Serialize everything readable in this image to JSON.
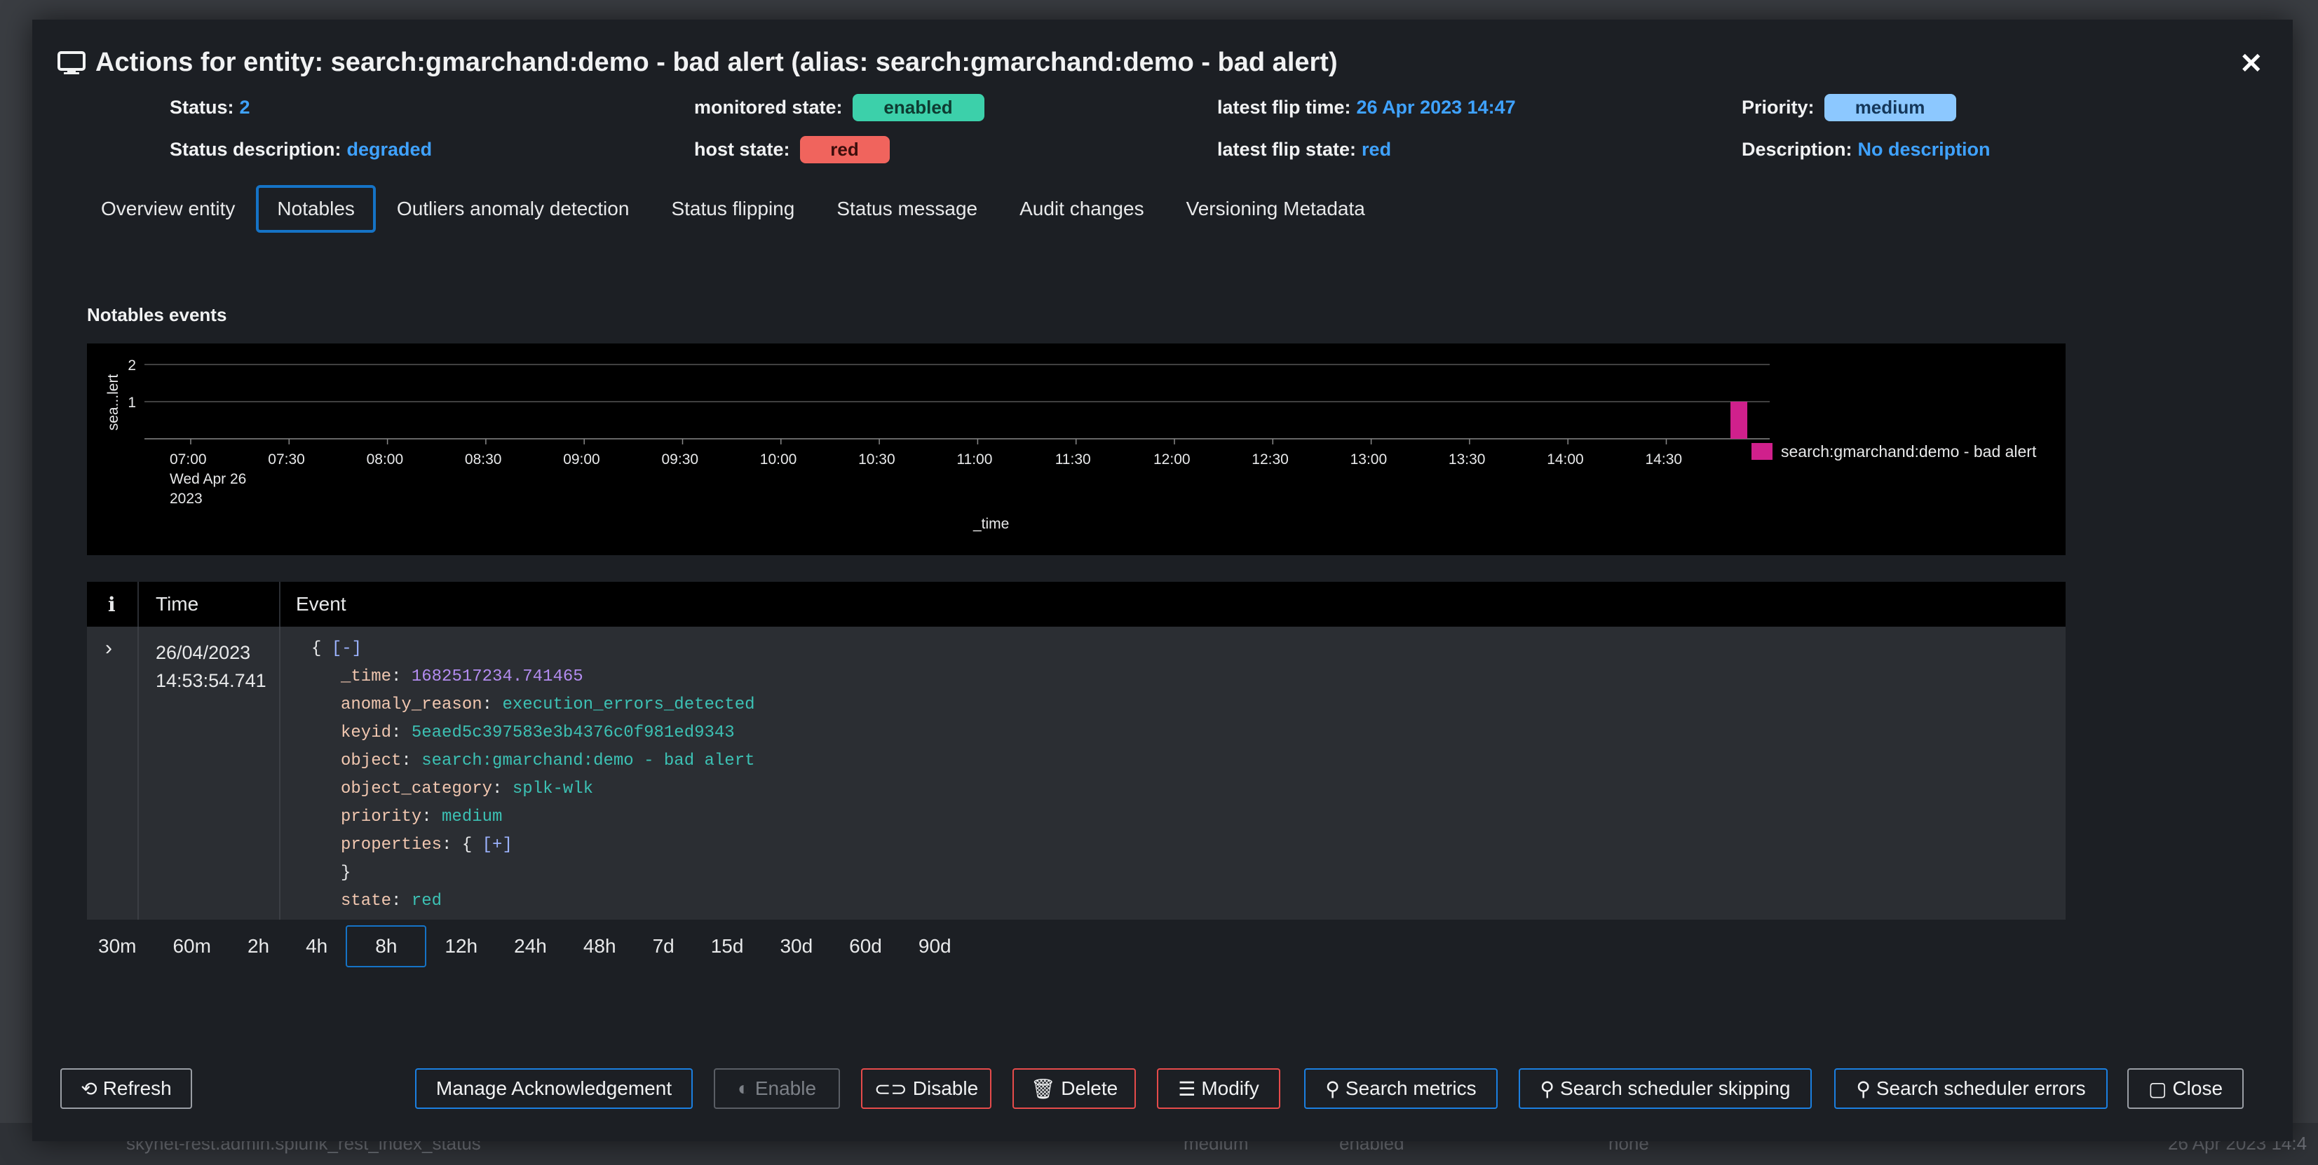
{
  "modal": {
    "title": "Actions for entity: search:gmarchand:demo - bad alert (alias: search:gmarchand:demo - bad alert)"
  },
  "info": {
    "status_label": "Status:",
    "status_value": "2",
    "status_desc_label": "Status description:",
    "status_desc_value": "degraded",
    "monitored_label": "monitored state:",
    "monitored_value": "enabled",
    "host_label": "host state:",
    "host_value": "red",
    "flip_time_label": "latest flip time:",
    "flip_time_value": "26 Apr 2023 14:47",
    "flip_state_label": "latest flip state:",
    "flip_state_value": "red",
    "priority_label": "Priority:",
    "priority_value": "medium",
    "description_label": "Description:",
    "description_value": "No description"
  },
  "tabs": [
    {
      "label": "Overview entity"
    },
    {
      "label": "Notables",
      "active": true
    },
    {
      "label": "Outliers anomaly detection"
    },
    {
      "label": "Status flipping"
    },
    {
      "label": "Status message"
    },
    {
      "label": "Audit changes"
    },
    {
      "label": "Versioning Metadata"
    }
  ],
  "section": {
    "title": "Notables events"
  },
  "chart_data": {
    "type": "bar",
    "ylabel": "sea...lert",
    "xlabel": "_time",
    "yticks": [
      "2",
      "1"
    ],
    "ylim": [
      0,
      2
    ],
    "x_ticks": [
      "07:00",
      "07:30",
      "08:00",
      "08:30",
      "09:00",
      "09:30",
      "10:00",
      "10:30",
      "11:00",
      "11:30",
      "12:00",
      "12:30",
      "13:00",
      "13:30",
      "14:00",
      "14:30"
    ],
    "first_tick_date": [
      "Wed Apr 26",
      "2023"
    ],
    "series": [
      {
        "name": "search:gmarchand:demo - bad alert",
        "color": "#d0208c",
        "points": [
          {
            "x": "14:50",
            "y": 1
          }
        ]
      }
    ],
    "legend": "right",
    "grid": true
  },
  "table": {
    "headers": {
      "info": "i",
      "time": "Time",
      "event": "Event"
    },
    "row": {
      "date": "26/04/2023",
      "time": "14:53:54.741",
      "open": "{",
      "collapse": "[-]",
      "fields": [
        {
          "key": "_time",
          "value": "1682517234.741465",
          "kind": "n"
        },
        {
          "key": "anomaly_reason",
          "value": "execution_errors_detected",
          "kind": "s"
        },
        {
          "key": "keyid",
          "value": "5eaed5c397583e3b4376c0f981ed9343",
          "kind": "s"
        },
        {
          "key": "object",
          "value": "search:gmarchand:demo - bad alert",
          "kind": "s"
        },
        {
          "key": "object_category",
          "value": "splk-wlk",
          "kind": "s"
        },
        {
          "key": "priority",
          "value": "medium",
          "kind": "s"
        }
      ],
      "properties_key": "properties",
      "properties_open": "{",
      "expand": "[+]",
      "close": "}",
      "state_key": "state",
      "state_value": "red"
    }
  },
  "ranges": [
    "30m",
    "60m",
    "2h",
    "4h",
    "8h",
    "12h",
    "24h",
    "48h",
    "7d",
    "15d",
    "30d",
    "60d",
    "90d"
  ],
  "active_range": "8h",
  "buttons": {
    "refresh": "Refresh",
    "ack": "Manage Acknowledgement",
    "enable": "Enable",
    "disable": "Disable",
    "delete": "Delete",
    "modify": "Modify",
    "search_metrics": "Search metrics",
    "search_skipping": "Search scheduler skipping",
    "search_errors": "Search scheduler errors",
    "close": "Close"
  },
  "background": {
    "bottom_row": "skynet-rest.admin.splunk_rest_index_status",
    "bottom_priority": "medium",
    "bottom_state": "enabled",
    "bottom_ack": "none",
    "bottom_time": "26 Apr 2023 14:4"
  }
}
